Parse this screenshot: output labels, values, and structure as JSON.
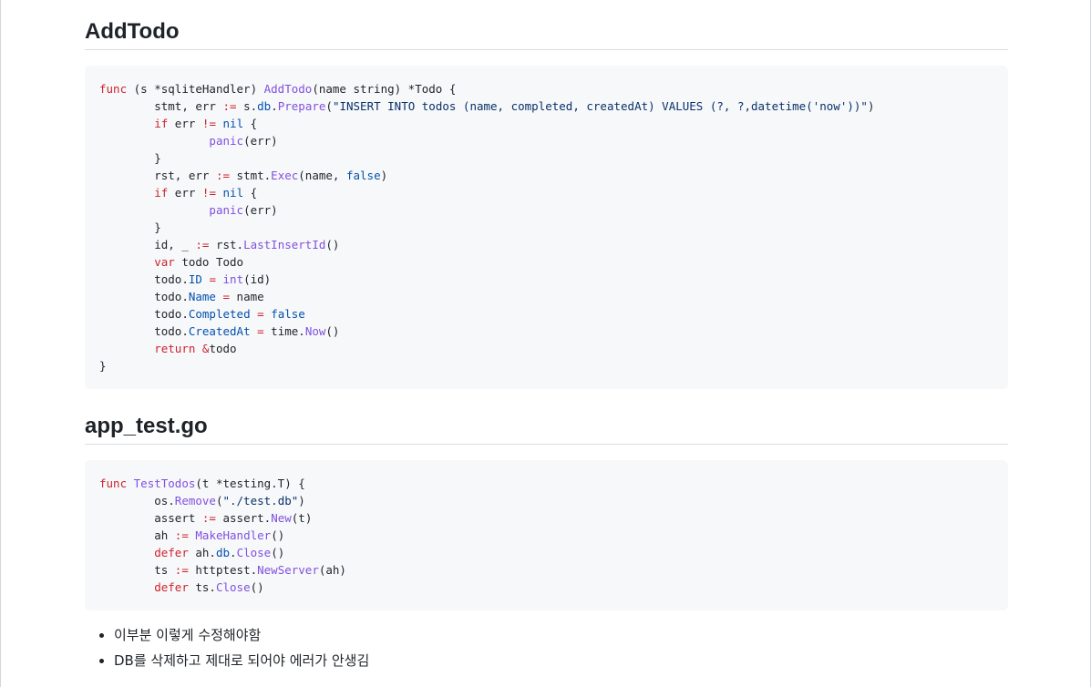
{
  "sections": [
    {
      "heading": "AddTodo",
      "code_lines": [
        [
          [
            "kw",
            "func"
          ],
          [
            "pl",
            " (s *sqliteHandler) "
          ],
          [
            "fn",
            "AddTodo"
          ],
          [
            "pl",
            "(name string) *Todo {"
          ]
        ],
        [
          [
            "pl",
            "\tstmt, err "
          ],
          [
            "kw",
            ":="
          ],
          [
            "pl",
            " s."
          ],
          [
            "cn",
            "db"
          ],
          [
            "pl",
            "."
          ],
          [
            "fn",
            "Prepare"
          ],
          [
            "pl",
            "("
          ],
          [
            "st",
            "\"INSERT INTO todos (name, completed, createdAt) VALUES (?, ?,datetime('now'))\""
          ],
          [
            "pl",
            ")"
          ]
        ],
        [
          [
            "pl",
            "\t"
          ],
          [
            "kw",
            "if"
          ],
          [
            "pl",
            " err "
          ],
          [
            "kw",
            "!="
          ],
          [
            "pl",
            " "
          ],
          [
            "cn",
            "nil"
          ],
          [
            "pl",
            " {"
          ]
        ],
        [
          [
            "pl",
            "\t\t"
          ],
          [
            "fn",
            "panic"
          ],
          [
            "pl",
            "(err)"
          ]
        ],
        [
          [
            "pl",
            "\t}"
          ]
        ],
        [
          [
            "pl",
            "\trst, err "
          ],
          [
            "kw",
            ":="
          ],
          [
            "pl",
            " stmt."
          ],
          [
            "fn",
            "Exec"
          ],
          [
            "pl",
            "(name, "
          ],
          [
            "cn",
            "false"
          ],
          [
            "pl",
            ")"
          ]
        ],
        [
          [
            "pl",
            "\t"
          ],
          [
            "kw",
            "if"
          ],
          [
            "pl",
            " err "
          ],
          [
            "kw",
            "!="
          ],
          [
            "pl",
            " "
          ],
          [
            "cn",
            "nil"
          ],
          [
            "pl",
            " {"
          ]
        ],
        [
          [
            "pl",
            "\t\t"
          ],
          [
            "fn",
            "panic"
          ],
          [
            "pl",
            "(err)"
          ]
        ],
        [
          [
            "pl",
            "\t}"
          ]
        ],
        [
          [
            "pl",
            "\tid, _ "
          ],
          [
            "kw",
            ":="
          ],
          [
            "pl",
            " rst."
          ],
          [
            "fn",
            "LastInsertId"
          ],
          [
            "pl",
            "()"
          ]
        ],
        [
          [
            "pl",
            "\t"
          ],
          [
            "kw",
            "var"
          ],
          [
            "pl",
            " todo Todo"
          ]
        ],
        [
          [
            "pl",
            "\ttodo."
          ],
          [
            "cn",
            "ID"
          ],
          [
            "pl",
            " "
          ],
          [
            "kw",
            "="
          ],
          [
            "pl",
            " "
          ],
          [
            "fn",
            "int"
          ],
          [
            "pl",
            "(id)"
          ]
        ],
        [
          [
            "pl",
            "\ttodo."
          ],
          [
            "cn",
            "Name"
          ],
          [
            "pl",
            " "
          ],
          [
            "kw",
            "="
          ],
          [
            "pl",
            " name"
          ]
        ],
        [
          [
            "pl",
            "\ttodo."
          ],
          [
            "cn",
            "Completed"
          ],
          [
            "pl",
            " "
          ],
          [
            "kw",
            "="
          ],
          [
            "pl",
            " "
          ],
          [
            "cn",
            "false"
          ]
        ],
        [
          [
            "pl",
            "\ttodo."
          ],
          [
            "cn",
            "CreatedAt"
          ],
          [
            "pl",
            " "
          ],
          [
            "kw",
            "="
          ],
          [
            "pl",
            " time."
          ],
          [
            "fn",
            "Now"
          ],
          [
            "pl",
            "()"
          ]
        ],
        [
          [
            "pl",
            "\t"
          ],
          [
            "kw",
            "return"
          ],
          [
            "pl",
            " "
          ],
          [
            "kw",
            "&"
          ],
          [
            "pl",
            "todo"
          ]
        ],
        [
          [
            "pl",
            "}"
          ]
        ]
      ]
    },
    {
      "heading": "app_test.go",
      "code_lines": [
        [
          [
            "kw",
            "func"
          ],
          [
            "pl",
            " "
          ],
          [
            "fn",
            "TestTodos"
          ],
          [
            "pl",
            "(t *testing.T) {"
          ]
        ],
        [
          [
            "pl",
            "\tos."
          ],
          [
            "fn",
            "Remove"
          ],
          [
            "pl",
            "("
          ],
          [
            "st",
            "\"./test.db\""
          ],
          [
            "pl",
            ")"
          ]
        ],
        [
          [
            "pl",
            "\tassert "
          ],
          [
            "kw",
            ":="
          ],
          [
            "pl",
            " assert."
          ],
          [
            "fn",
            "New"
          ],
          [
            "pl",
            "(t)"
          ]
        ],
        [
          [
            "pl",
            "\tah "
          ],
          [
            "kw",
            ":="
          ],
          [
            "pl",
            " "
          ],
          [
            "fn",
            "MakeHandler"
          ],
          [
            "pl",
            "()"
          ]
        ],
        [
          [
            "pl",
            "\t"
          ],
          [
            "kw",
            "defer"
          ],
          [
            "pl",
            " ah."
          ],
          [
            "cn",
            "db"
          ],
          [
            "pl",
            "."
          ],
          [
            "fn",
            "Close"
          ],
          [
            "pl",
            "()"
          ]
        ],
        [
          [
            "pl",
            "\tts "
          ],
          [
            "kw",
            ":="
          ],
          [
            "pl",
            " httptest."
          ],
          [
            "fn",
            "NewServer"
          ],
          [
            "pl",
            "(ah)"
          ]
        ],
        [
          [
            "pl",
            "\t"
          ],
          [
            "kw",
            "defer"
          ],
          [
            "pl",
            " ts."
          ],
          [
            "fn",
            "Close"
          ],
          [
            "pl",
            "()"
          ]
        ]
      ]
    }
  ],
  "bullets": [
    "이부분 이렇게 수정해야함",
    "DB를 삭제하고 제대로 되어야 에러가 안생김"
  ],
  "colors": {
    "keyword": "#cf222e",
    "function": "#8250df",
    "constant": "#0550ae",
    "string": "#0a3069",
    "code_background": "#f6f8fa"
  }
}
